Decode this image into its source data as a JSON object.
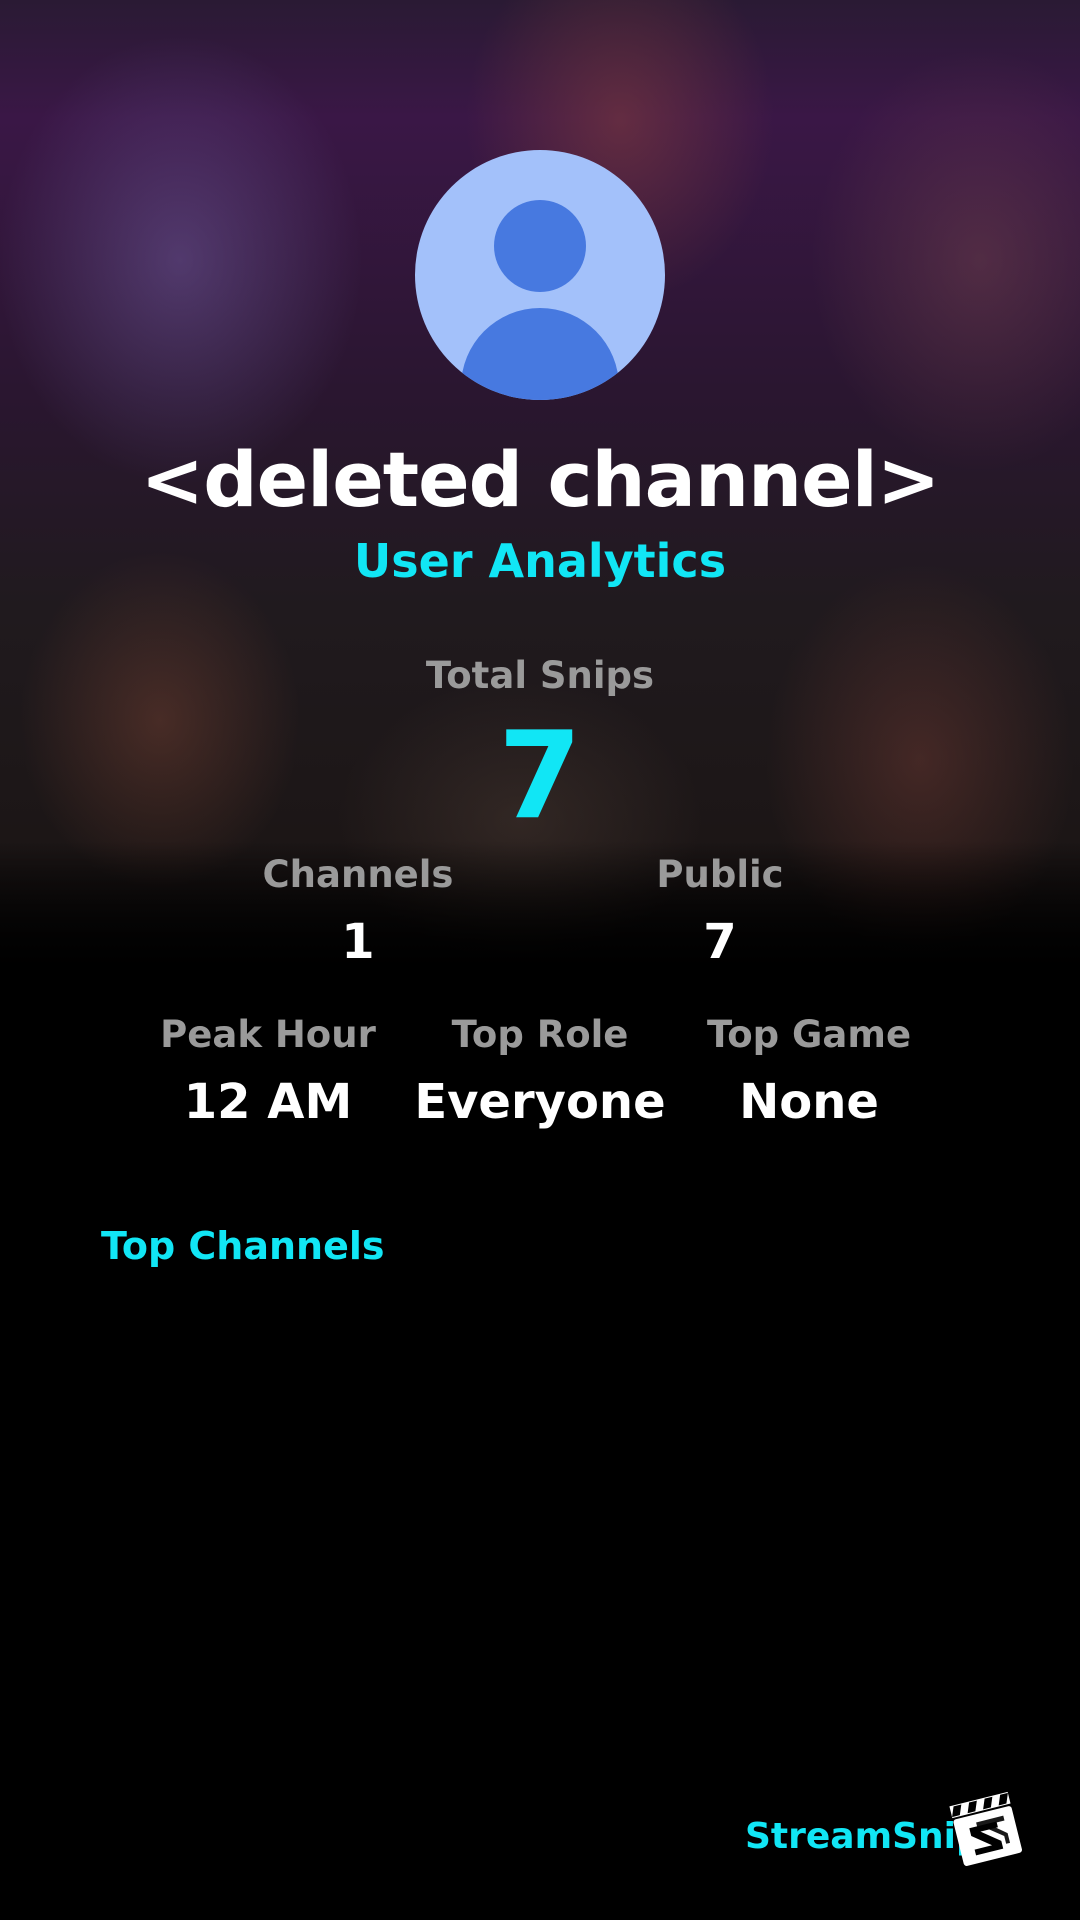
{
  "profile": {
    "channel_name": "<deleted channel>",
    "subtitle": "User Analytics"
  },
  "stats": {
    "total_label": "Total Snips",
    "total_value": "7",
    "channels_label": "Channels",
    "channels_value": "1",
    "public_label": "Public",
    "public_value": "7",
    "peak_hour_label": "Peak Hour",
    "peak_hour_value": "12 AM",
    "top_role_label": "Top Role",
    "top_role_value": "Everyone",
    "top_game_label": "Top Game",
    "top_game_value": "None"
  },
  "sections": {
    "top_channels_title": "Top Channels"
  },
  "brand": {
    "name": "StreamSnip"
  },
  "colors": {
    "accent": "#11e6f5",
    "background": "#000000",
    "label": "#9a9a9a",
    "avatar_bg": "#a3c1fa",
    "avatar_fg": "#4779e0"
  },
  "icons": {
    "avatar": "default-user-avatar-icon",
    "brand_logo": "clapperboard-logo-icon"
  }
}
